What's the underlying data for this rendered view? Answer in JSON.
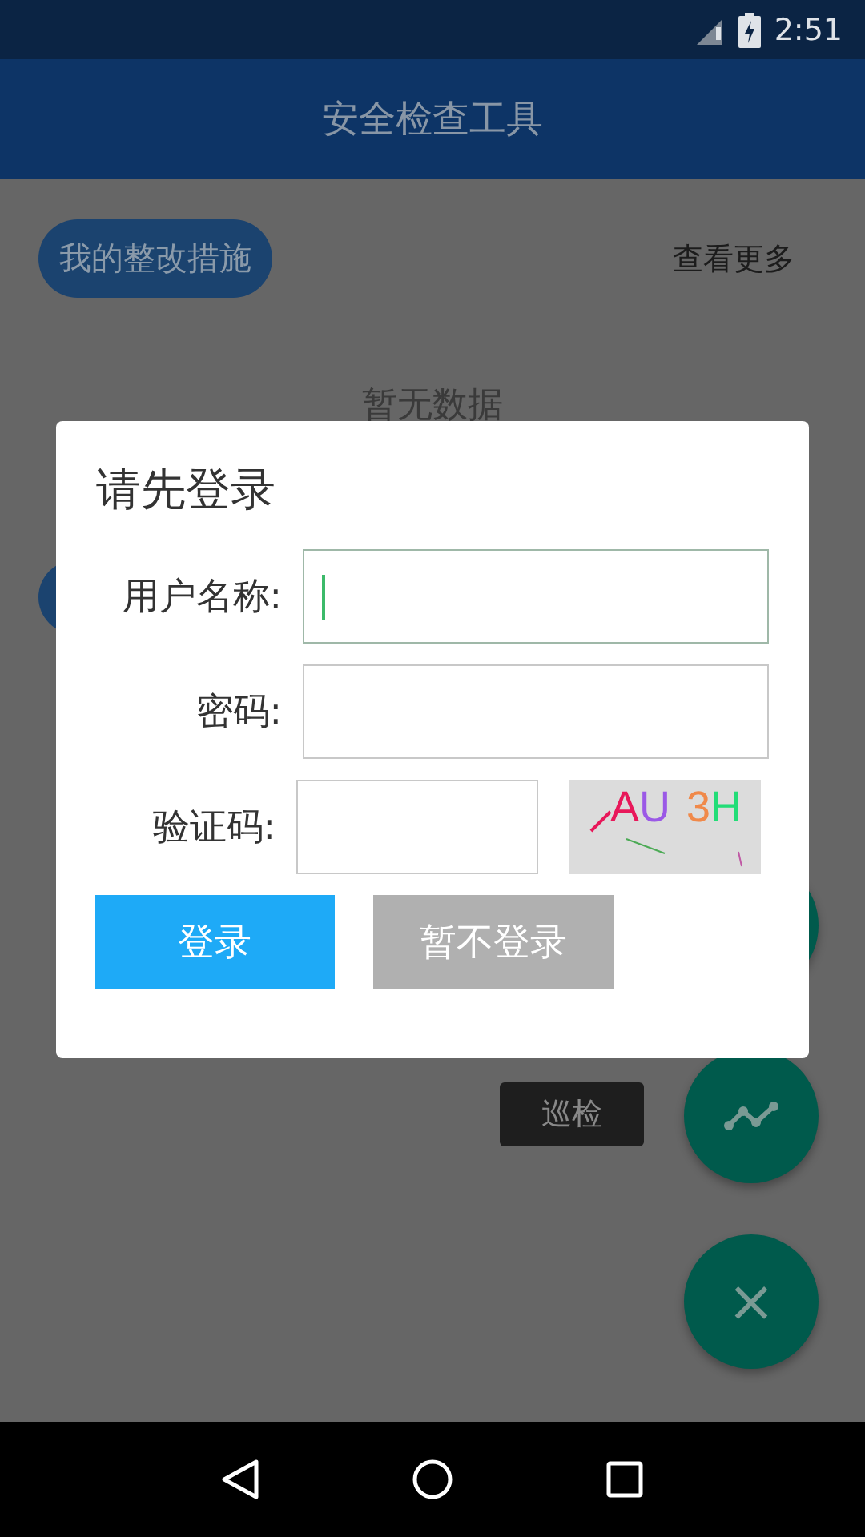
{
  "status_bar": {
    "time": "2:51"
  },
  "app_bar": {
    "title": "安全检查工具"
  },
  "page": {
    "my_measures_button": "我的整改措施",
    "more_link": "查看更多",
    "empty_text": "暂无数据"
  },
  "fab_menu": {
    "label": "巡检",
    "close_symbol": "×"
  },
  "dialog": {
    "title": "请先登录",
    "fields": [
      {
        "label": "用户名称:",
        "focused": true,
        "kind": "text"
      },
      {
        "label": "密码:",
        "focused": false,
        "kind": "password"
      },
      {
        "label": "验证码:",
        "focused": false,
        "kind": "captcha"
      }
    ],
    "captcha": [
      {
        "char": "A",
        "color": "#e8185a"
      },
      {
        "char": "U",
        "color": "#9b59e6"
      },
      {
        "char": "3",
        "color": "#f0894a"
      },
      {
        "char": "H",
        "color": "#22dd77"
      }
    ],
    "buttons": [
      {
        "label": "登录",
        "kind": "primary"
      },
      {
        "label": "暂不登录",
        "kind": "secondary"
      }
    ]
  }
}
